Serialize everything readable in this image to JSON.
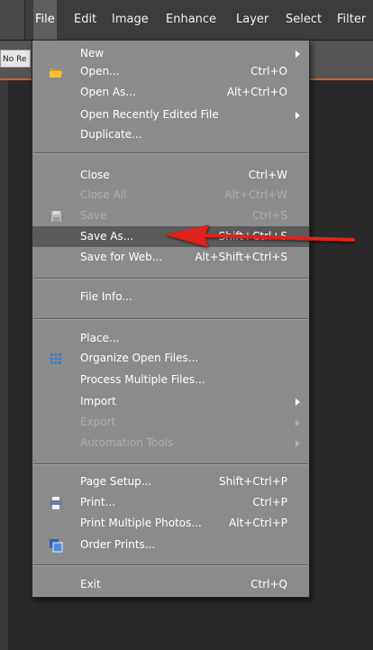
{
  "menubar": {
    "items": [
      "File",
      "Edit",
      "Image",
      "Enhance",
      "Layer",
      "Select",
      "Filter"
    ]
  },
  "options_bar": {
    "truncated_field": "No Re"
  },
  "file_menu": {
    "items": [
      {
        "label": "New",
        "shortcut": "",
        "submenu": true
      },
      {
        "label": "Open...",
        "shortcut": "Ctrl+O",
        "icon": "folder-icon"
      },
      {
        "label": "Open As...",
        "shortcut": "Alt+Ctrl+O"
      },
      {
        "label": "Open Recently Edited File",
        "shortcut": "",
        "submenu": true
      },
      {
        "label": "Duplicate...",
        "shortcut": ""
      },
      {
        "label": "Close",
        "shortcut": "Ctrl+W"
      },
      {
        "label": "Close All",
        "shortcut": "Alt+Ctrl+W",
        "disabled": true
      },
      {
        "label": "Save",
        "shortcut": "Ctrl+S",
        "disabled": true,
        "icon": "save-disk-icon"
      },
      {
        "label": "Save As...",
        "shortcut": "Shift+Ctrl+S",
        "highlighted": true
      },
      {
        "label": "Save for Web...",
        "shortcut": "Alt+Shift+Ctrl+S"
      },
      {
        "label": "File Info...",
        "shortcut": ""
      },
      {
        "label": "Place...",
        "shortcut": ""
      },
      {
        "label": "Organize Open Files...",
        "shortcut": "",
        "icon": "grid-icon"
      },
      {
        "label": "Process Multiple Files...",
        "shortcut": ""
      },
      {
        "label": "Import",
        "shortcut": "",
        "submenu": true
      },
      {
        "label": "Export",
        "shortcut": "",
        "submenu": true,
        "disabled": true
      },
      {
        "label": "Automation Tools",
        "shortcut": "",
        "submenu": true,
        "disabled": true
      },
      {
        "label": "Page Setup...",
        "shortcut": "Shift+Ctrl+P"
      },
      {
        "label": "Print...",
        "shortcut": "Ctrl+P",
        "icon": "printer-icon"
      },
      {
        "label": "Print Multiple Photos...",
        "shortcut": "Alt+Ctrl+P"
      },
      {
        "label": "Order Prints...",
        "shortcut": "",
        "icon": "order-prints-icon"
      },
      {
        "label": "Exit",
        "shortcut": "Ctrl+Q"
      }
    ]
  },
  "colors": {
    "menu_bg": "#8b8b8b",
    "highlight": "#5a5a5a",
    "annotation_arrow": "#e0201c"
  }
}
